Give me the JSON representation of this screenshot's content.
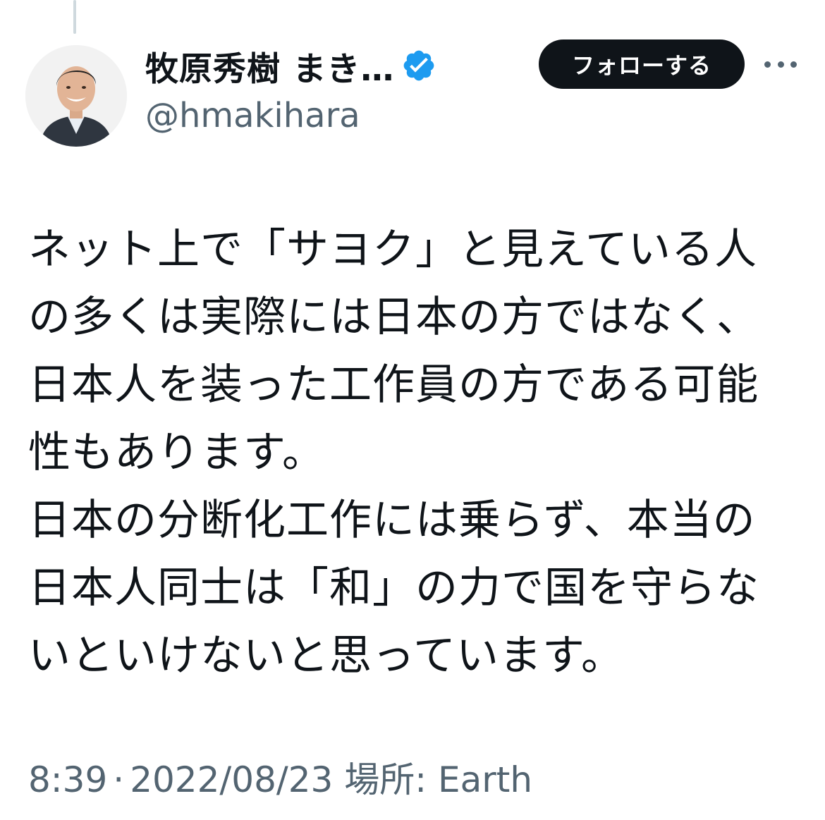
{
  "tweet": {
    "author": {
      "display_name": "牧原秀樹 まき…",
      "handle": "@hmakihara",
      "verified": true,
      "verified_color": "#1d9bf0"
    },
    "follow_label": "フォローする",
    "more_icon": "more-horizontal-icon",
    "text_lines": [
      "ネット上で「サヨク」と見えている人",
      "の多くは実際には日本の方ではなく、",
      "日本人を装った工作員の方である可能",
      "性もあります。",
      "日本の分断化工作には乗らず、本当の",
      "日本人同士は「和」の力で国を守らな",
      "いといけないと思っています。"
    ],
    "time": "8:39",
    "separator": "·",
    "date": "2022/08/23",
    "location": "場所: Earth"
  }
}
